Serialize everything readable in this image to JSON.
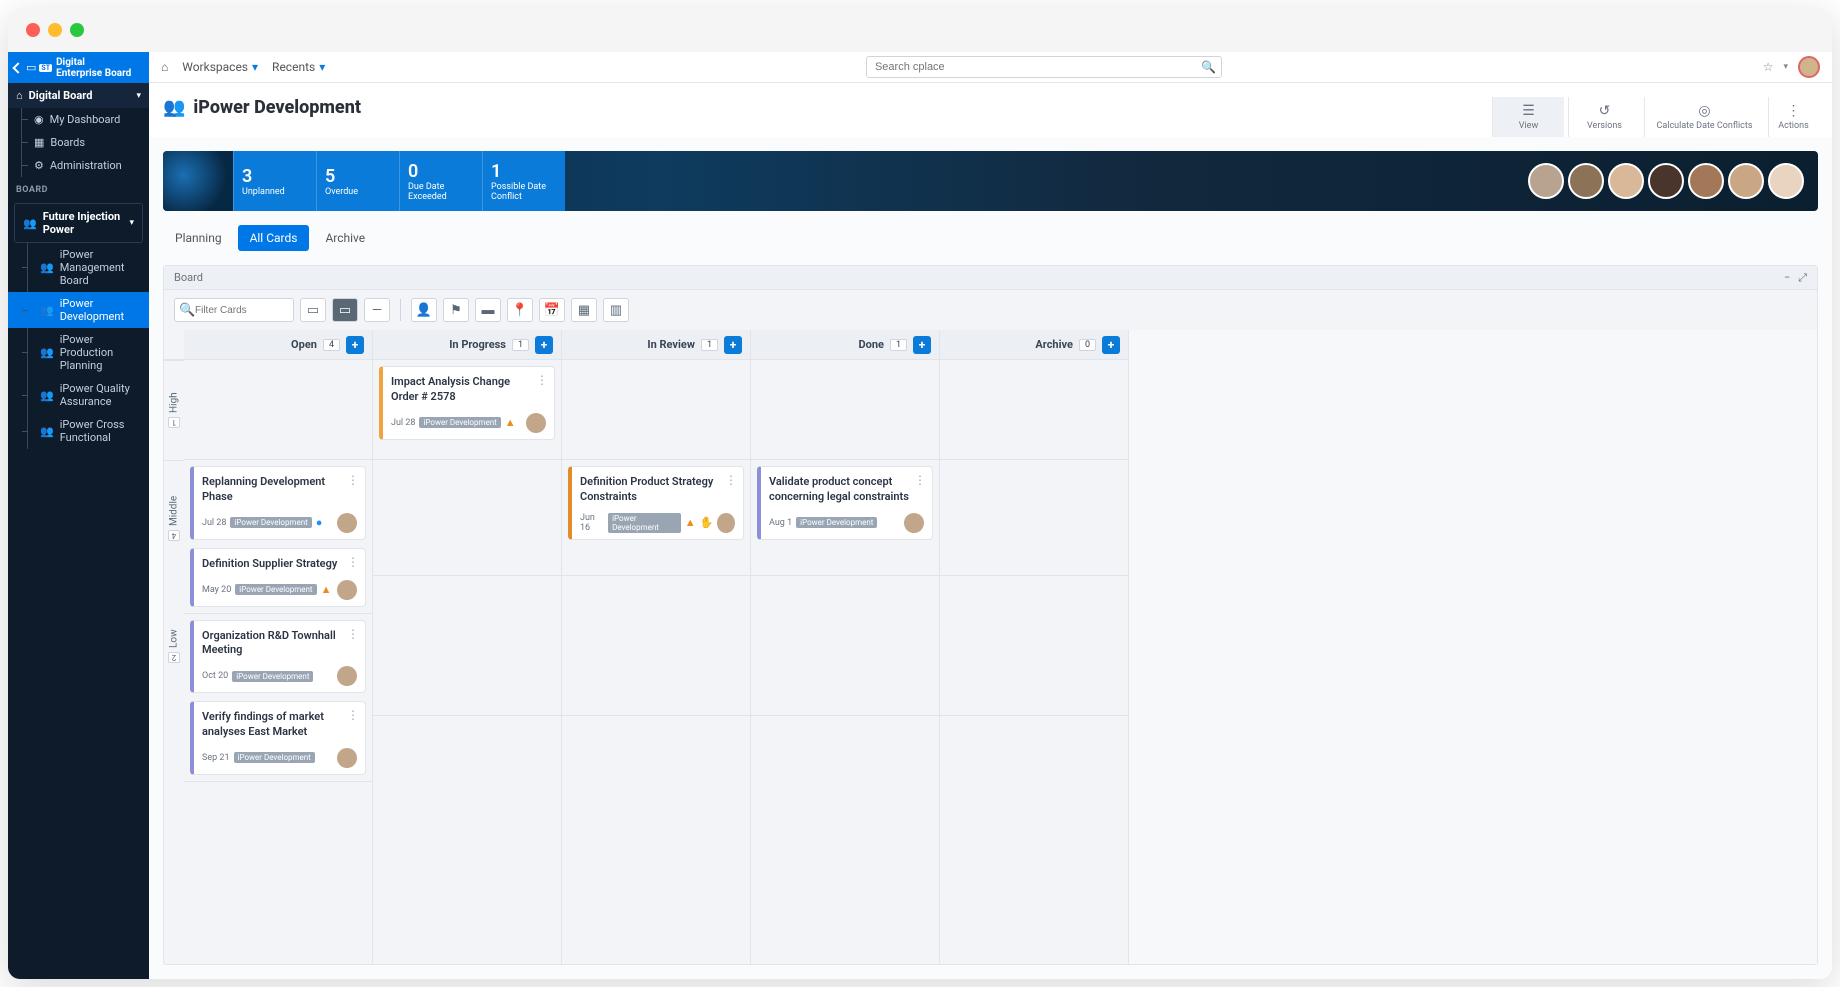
{
  "browser": {
    "title": "Digital Enterprise Board"
  },
  "sidebar": {
    "top_line1": "Digital",
    "top_line2": "Enterprise Board",
    "top_badge": "ST",
    "main_section": "Digital Board",
    "items": [
      {
        "label": "My Dashboard"
      },
      {
        "label": "Boards"
      },
      {
        "label": "Administration"
      }
    ],
    "board_label": "BOARD",
    "board_section": "Future Injection Power",
    "board_items": [
      {
        "label": "iPower Management Board"
      },
      {
        "label": "iPower Development",
        "active": true
      },
      {
        "label": "iPower Production Planning"
      },
      {
        "label": "iPower Quality Assurance"
      },
      {
        "label": "iPower Cross Functional"
      }
    ]
  },
  "topbar": {
    "workspaces": "Workspaces",
    "recents": "Recents",
    "search_placeholder": "Search cplace"
  },
  "page": {
    "title": "iPower Development",
    "actions": {
      "view": "View",
      "versions": "Versions",
      "calc": "Calculate Date Conflicts",
      "actions": "Actions"
    }
  },
  "stats": [
    {
      "num": "3",
      "lbl": "Unplanned"
    },
    {
      "num": "5",
      "lbl": "Overdue"
    },
    {
      "num": "0",
      "lbl": "Due Date Exceeded"
    },
    {
      "num": "1",
      "lbl": "Possible Date Conflict"
    }
  ],
  "tabs": {
    "planning": "Planning",
    "all_cards": "All Cards",
    "archive": "Archive"
  },
  "board": {
    "title": "Board",
    "filter_placeholder": "Filter Cards",
    "columns": [
      {
        "name": "Open",
        "count": "4"
      },
      {
        "name": "In Progress",
        "count": "1"
      },
      {
        "name": "In Review",
        "count": "1"
      },
      {
        "name": "Done",
        "count": "1"
      },
      {
        "name": "Archive",
        "count": "0"
      }
    ],
    "lanes": {
      "high": {
        "label": "High",
        "count": "1"
      },
      "middle": {
        "label": "Middle",
        "count": "4"
      },
      "low": {
        "label": "Low",
        "count": "2"
      }
    },
    "cards": {
      "inprogress_high": {
        "title": "Impact Analysis Change Order # 2578",
        "date": "Jul 28",
        "tag": "iPower Development"
      },
      "open_mid_1": {
        "title": "Replanning Development Phase",
        "date": "Jul 28",
        "tag": "iPower Development"
      },
      "open_mid_2": {
        "title": "Definition Supplier Strategy",
        "date": "May 20",
        "tag": "iPower Development"
      },
      "inreview_mid": {
        "title": "Definition Product Strategy Constraints",
        "date": "Jun 16",
        "tag": "iPower Development"
      },
      "done_mid": {
        "title": "Validate product concept concerning legal constraints",
        "date": "Aug 1",
        "tag": "iPower Development"
      },
      "open_low_1": {
        "title": "Organization R&D Townhall Meeting",
        "date": "Oct 20",
        "tag": "iPower Development"
      },
      "open_low_2": {
        "title": "Verify findings of market analyses East Market",
        "date": "Sep 21",
        "tag": "iPower Development"
      }
    }
  }
}
